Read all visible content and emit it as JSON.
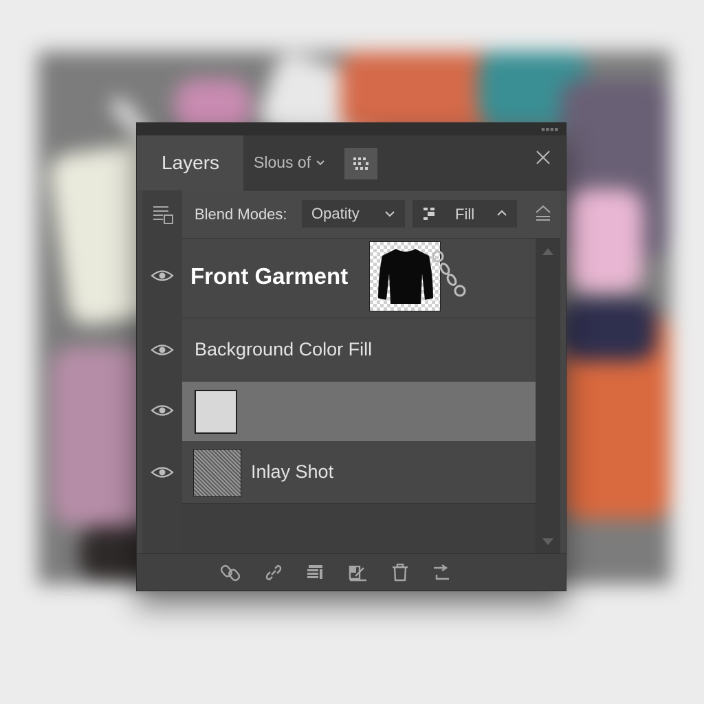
{
  "panel": {
    "tabs": [
      {
        "label": "Layers"
      },
      {
        "label": "Slous of"
      }
    ],
    "controls": {
      "blend_label": "Blend Modes:",
      "opacity_value": "Opatity",
      "fill_label": "Fill"
    },
    "layers": [
      {
        "name": "Front Garment",
        "visible": true,
        "thumbnail": "garment-shirt",
        "linked": true
      },
      {
        "name": "Background Color Fill",
        "visible": true
      },
      {
        "name": "",
        "visible": true,
        "thumbnail": "color-swatch",
        "selected": true,
        "swatch_color": "#d8d8d8"
      },
      {
        "name": "Inlay Shot",
        "visible": true,
        "thumbnail": "texture"
      }
    ],
    "footer_icons": [
      "link-icon",
      "chain-link-icon",
      "new-group-icon",
      "adjustment-icon",
      "trash-icon",
      "new-layer-icon"
    ]
  },
  "colors": {
    "panel_bg": "#464646",
    "selected_row": "#717171",
    "text": "#e4e4e4"
  }
}
